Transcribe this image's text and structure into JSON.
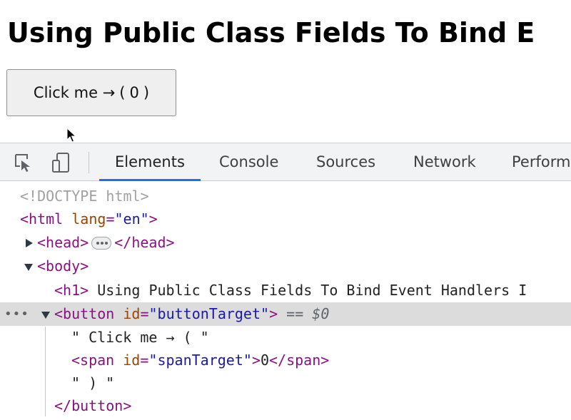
{
  "page": {
    "heading": "Using Public Class Fields To Bind E",
    "button_prefix": "Click me →",
    "button_open": "(",
    "button_count": "0",
    "button_close": ")"
  },
  "devtools": {
    "tools": [
      {
        "icon": "inspect-element-icon"
      },
      {
        "icon": "device-toolbar-icon"
      }
    ],
    "tabs": [
      {
        "label": "Elements",
        "active": true
      },
      {
        "label": "Console",
        "active": false
      },
      {
        "label": "Sources",
        "active": false
      },
      {
        "label": "Network",
        "active": false
      },
      {
        "label": "Perform",
        "active": false
      }
    ]
  },
  "dom_tree": {
    "doctype": "<!DOCTYPE html>",
    "html_open": "<html",
    "html_attr": "lang",
    "html_attr_val": "\"en\"",
    "html_close_bracket": ">",
    "head_open": "<head>",
    "head_close": "</head>",
    "body_open": "<body>",
    "h1_open": "<h1>",
    "h1_text": " Using Public Class Fields To Bind Event Handlers I",
    "button_open": "<button",
    "button_attr": "id",
    "button_attr_val": "\"buttonTarget\"",
    "button_close_bracket": ">",
    "selected_marker": "==",
    "selected_var": "$0",
    "text_1": "\" Click me → ( \"",
    "span_open": "<span",
    "span_attr": "id",
    "span_attr_val": "\"spanTarget\"",
    "span_close_bracket": ">",
    "span_text": "0",
    "span_close": "</span>",
    "text_2": "\" ) \"",
    "button_end": "</button>",
    "row_menu": "•••"
  },
  "colors": {
    "tag": "#881280",
    "attr_name": "#994500",
    "attr_value": "#1a1aa6",
    "active_tab_underline": "#1a73e8",
    "selected_row": "#dcdcdc"
  }
}
